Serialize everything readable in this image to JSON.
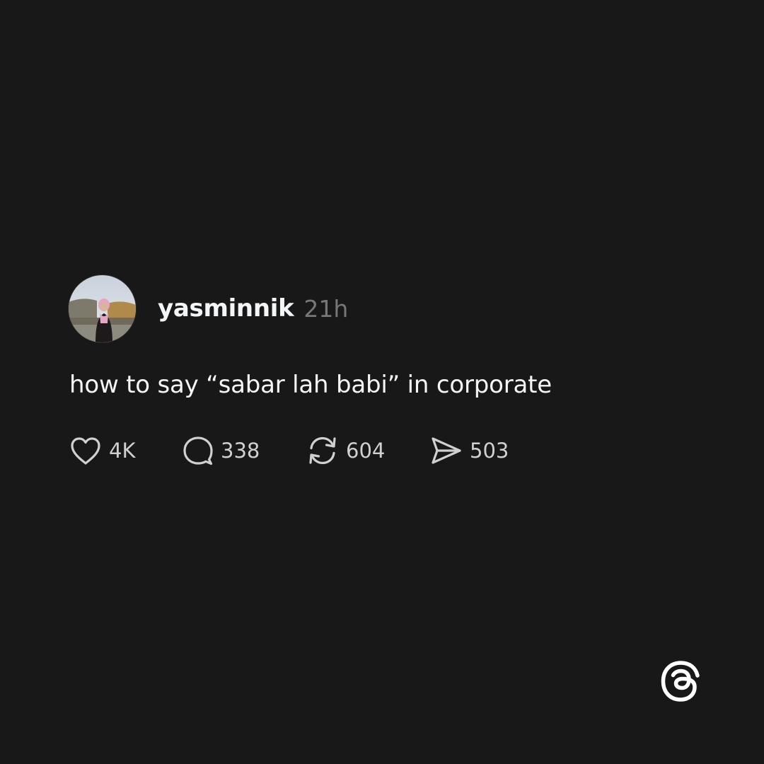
{
  "post": {
    "username": "yasminnik",
    "timestamp": "21h",
    "text": "how to say “sabar lah babi” in corporate",
    "avatar_icon": "profile-photo"
  },
  "actions": {
    "like": {
      "icon": "heart-icon",
      "count": "4K"
    },
    "reply": {
      "icon": "speech-bubble-icon",
      "count": "338"
    },
    "repost": {
      "icon": "repost-icon",
      "count": "604"
    },
    "share": {
      "icon": "paper-plane-icon",
      "count": "503"
    }
  },
  "brand": {
    "logo": "threads-logo-icon"
  },
  "colors": {
    "background": "#181818",
    "text_primary": "#f3f5f7",
    "text_secondary": "#777777",
    "icon": "#d0d0d0"
  }
}
